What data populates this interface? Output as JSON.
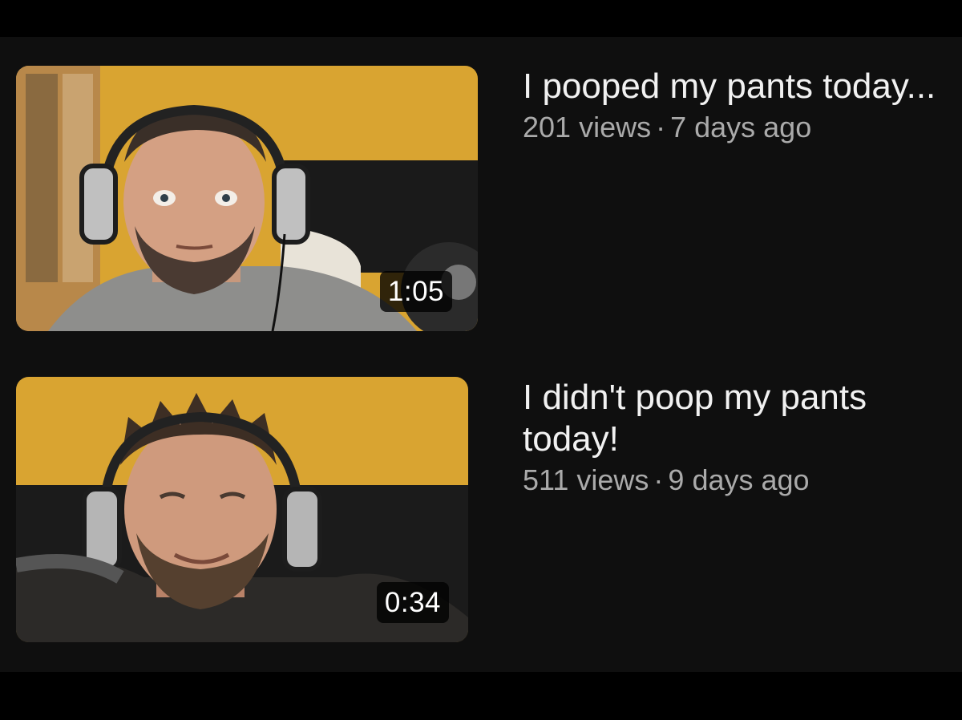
{
  "videos": [
    {
      "title": "I pooped my pants today...",
      "views": "201 views",
      "separator": "·",
      "age": "7 days ago",
      "duration": "1:05",
      "thumbnail": "man-with-headphones-wide-eyed"
    },
    {
      "title": "I didn't poop my pants today!",
      "views": "511 views",
      "separator": "·",
      "age": "9 days ago",
      "duration": "0:34",
      "thumbnail": "man-with-headphones-smiling"
    }
  ],
  "colors": {
    "background": "#0f0f0f",
    "letterbox": "#000000",
    "title_text": "#f1f1f1",
    "secondary_text": "#aaaaaa",
    "wall": "#d9a431"
  }
}
